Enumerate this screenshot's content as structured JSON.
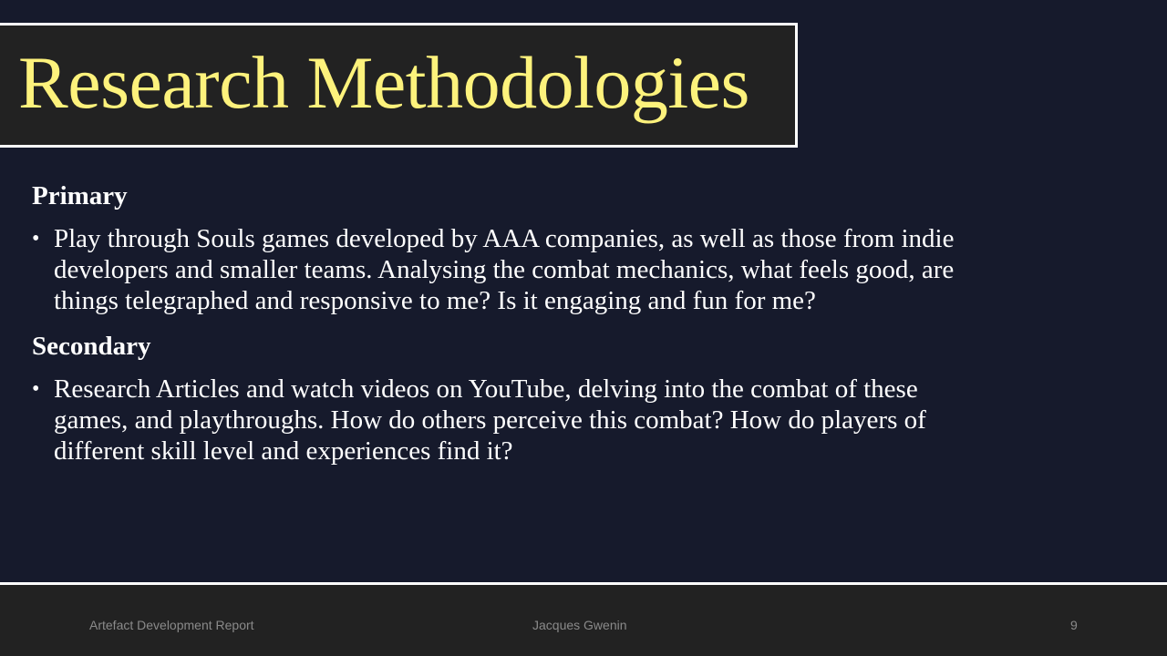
{
  "slide": {
    "title": "Research Methodologies",
    "sections": [
      {
        "heading": "Primary",
        "bullets": [
          "Play through Souls games developed by AAA companies, as well as those from indie developers and smaller teams. Analysing the combat mechanics, what feels good, are things telegraphed and responsive to me? Is it engaging and fun for me?"
        ]
      },
      {
        "heading": "Secondary",
        "bullets": [
          "Research Articles and watch videos on YouTube, delving into the combat of these games, and playthroughs. How do others perceive this combat? How do players of different skill level and experiences find it?"
        ]
      }
    ],
    "bullet_symbol": "•"
  },
  "footer": {
    "left": "Artefact Development Report",
    "center": "Jacques Gwenin",
    "page_number": "9"
  },
  "colors": {
    "background": "#161a2c",
    "title_box": "#222222",
    "title_text": "#fdf27c",
    "body_text": "#ffffff",
    "footer_text": "#8a8a8a"
  }
}
